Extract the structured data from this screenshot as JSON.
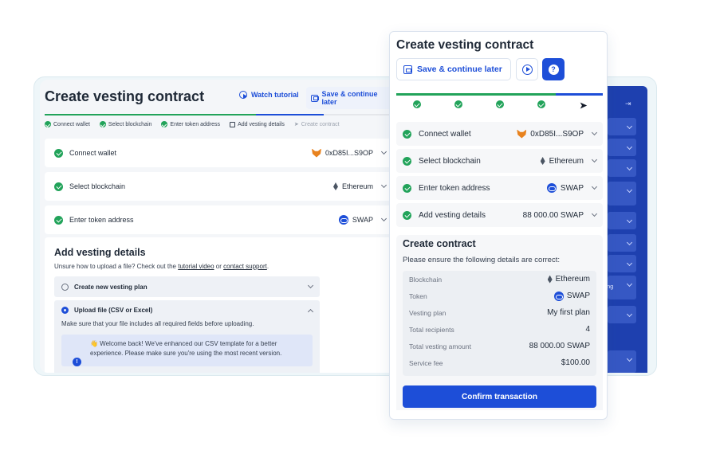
{
  "back": {
    "title": "Create vesting contract",
    "watch_tutorial": "Watch tutorial",
    "save_continue": "Save & continue later",
    "steps": [
      "Connect wallet",
      "Select blockchain",
      "Enter token address",
      "Add vesting details",
      "Create contract"
    ],
    "rows": [
      {
        "label": "Connect wallet",
        "value": "0xD85I...S9OP",
        "icon": "metamask-fox-icon"
      },
      {
        "label": "Select blockchain",
        "value": "Ethereum",
        "icon": "ethereum-icon"
      },
      {
        "label": "Enter token address",
        "value": "SWAP",
        "icon": "swap-token-icon"
      }
    ],
    "vesting": {
      "title": "Add vesting details",
      "hint_prefix": "Unsure how to upload a file? Check out the ",
      "hint_link1": "tutorial video",
      "hint_mid": " or ",
      "hint_link2": "contact support",
      "hint_suffix": ".",
      "option1": "Create new vesting plan",
      "option2": "Upload file (CSV or Excel)",
      "option2_desc": "Make sure that your file includes all required fields before uploading.",
      "welcome": "👋 Welcome back! We've enhanced our CSV template for a better experience. Please make sure you're using the most recent version."
    },
    "sidebar_label": "ng"
  },
  "front": {
    "title": "Create vesting contract",
    "save_continue": "Save & continue later",
    "rows": [
      {
        "label": "Connect wallet",
        "value": "0xD85I...S9OP",
        "icon": "metamask-fox-icon"
      },
      {
        "label": "Select blockchain",
        "value": "Ethereum",
        "icon": "ethereum-icon"
      },
      {
        "label": "Enter token address",
        "value": "SWAP",
        "icon": "swap-token-icon"
      },
      {
        "label": "Add vesting details",
        "value": "88 000.00 SWAP"
      }
    ],
    "create": {
      "title": "Create contract",
      "subtitle": "Please ensure the following details are correct:",
      "summary": [
        {
          "label": "Blockchain",
          "value": "Ethereum"
        },
        {
          "label": "Token",
          "value": "SWAP"
        },
        {
          "label": "Vesting plan",
          "value": "My first plan"
        },
        {
          "label": "Total recipients",
          "value": "4"
        },
        {
          "label": "Total vesting amount",
          "value": "88 000.00 SWAP"
        },
        {
          "label": "Service fee",
          "value": "$100.00"
        }
      ],
      "confirm": "Confirm transaction"
    }
  },
  "colors": {
    "primary": "#1d4ed8",
    "success": "#22a35a",
    "sidebar": "#1e40af"
  }
}
